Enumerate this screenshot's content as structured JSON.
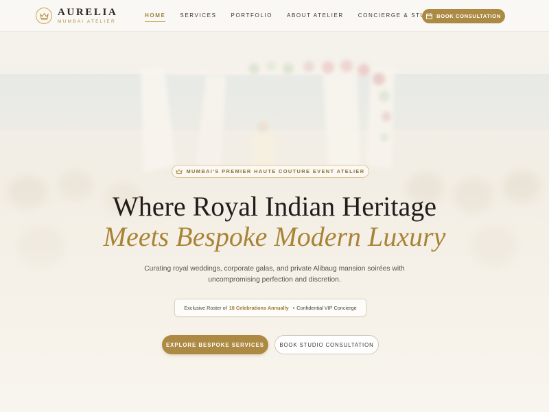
{
  "header": {
    "brand": "AURELIA",
    "brand_sub": "MUMBAI ATELIER",
    "nav": [
      {
        "label": "HOME",
        "active": true
      },
      {
        "label": "SERVICES",
        "active": false
      },
      {
        "label": "PORTFOLIO",
        "active": false
      },
      {
        "label": "ABOUT ATELIER",
        "active": false
      },
      {
        "label": "CONCIERGE & STUDIO",
        "active": false
      }
    ],
    "cta_label": "BOOK CONSULTATION"
  },
  "hero": {
    "badge": "MUMBAI'S PREMIER HAUTE COUTURE EVENT ATELIER",
    "title_line1": "Where Royal Indian Heritage",
    "title_line2": "Meets Bespoke Modern Luxury",
    "description_line1": "Curating royal weddings, corporate galas, and private Alibaug mansion soirées with",
    "description_line2": "uncompromising perfection and discretion.",
    "pill": {
      "prefix": "Exclusive Roster of",
      "highlight": "18 Celebrations Annually",
      "separator": "•",
      "suffix": "Confidential VIP Concierge"
    },
    "primary_button": "EXPLORE BESPOKE SERVICES",
    "secondary_button": "BOOK STUDIO CONSULTATION"
  },
  "icons": {
    "logo": "crown-icon",
    "cta": "calendar-icon",
    "badge": "crown-icon",
    "background": "wedding-arch-photo"
  },
  "colors": {
    "accent_gold": "#ad8a43",
    "title_dark": "#211d19",
    "title_gold": "#a98436",
    "background": "#f7f3ec"
  }
}
